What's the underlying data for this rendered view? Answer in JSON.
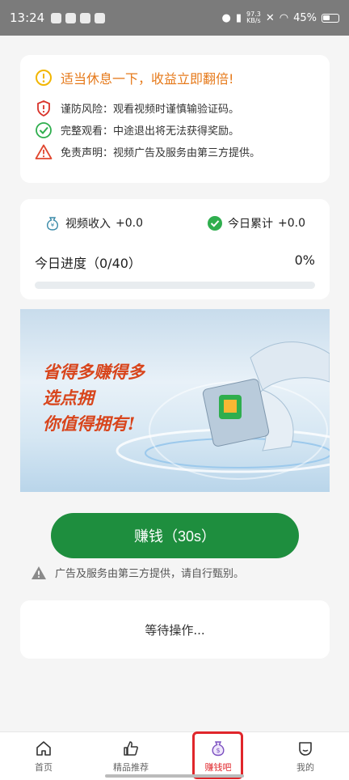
{
  "status": {
    "time": "13:24",
    "speed": "97.3",
    "speed_unit": "KB/s",
    "battery": "45%"
  },
  "notice": {
    "title": "适当休息一下，收益立即翻倍!",
    "rows": [
      {
        "icon": "shield-icon",
        "text": "谨防风险：观看视频时谨慎输验证码。"
      },
      {
        "icon": "check-circle-icon",
        "text": "完整观看：中途退出将无法获得奖励。"
      },
      {
        "icon": "warning-icon",
        "text": "免责声明：视频广告及服务由第三方提供。"
      }
    ]
  },
  "earnings": {
    "video_income_label": "视频收入",
    "video_income_value": "+0.0",
    "today_total_label": "今日累计",
    "today_total_value": "+0.0",
    "progress_label": "今日进度（0/40）",
    "progress_percent": "0%",
    "progress_fraction": 0
  },
  "banner": {
    "lines": [
      "省得多赚得多",
      "选点拥",
      "你值得拥有!"
    ]
  },
  "earn_button": "赚钱（30s）",
  "disclaimer": "广告及服务由第三方提供，请自行甄别。",
  "wait_text": "等待操作...",
  "tabs": [
    {
      "label": "首页",
      "icon": "home-icon"
    },
    {
      "label": "精品推荐",
      "icon": "thumbs-up-icon"
    },
    {
      "label": "赚钱吧",
      "icon": "money-bag-icon"
    },
    {
      "label": "我的",
      "icon": "profile-icon"
    }
  ],
  "colors": {
    "accent": "#1e8e3e",
    "warning": "#e67a1b",
    "active_tab": "#e0262b"
  }
}
